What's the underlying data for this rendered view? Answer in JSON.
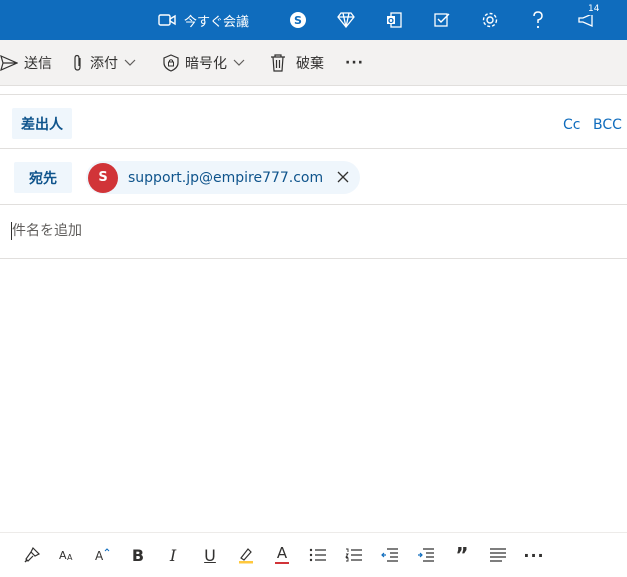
{
  "topbar": {
    "meet_now_label": "今すぐ会議",
    "notification_count": "14",
    "icons": [
      "video-icon",
      "skype-icon",
      "diamond-icon",
      "office-icon",
      "todo-icon",
      "gear-icon",
      "help-icon",
      "megaphone-icon"
    ],
    "accent": "#0f6cbd"
  },
  "toolbar": {
    "send_label": "送信",
    "attach_label": "添付",
    "encrypt_label": "暗号化",
    "discard_label": "破棄",
    "more_label": "···"
  },
  "compose": {
    "from_label": "差出人",
    "cc_label": "Cc",
    "bcc_label": "BCC",
    "to_label": "宛先",
    "recipient": {
      "initial": "S",
      "email": "support.jp@empire777.com",
      "avatar_color": "#d13438"
    },
    "subject_placeholder": "件名を追加"
  },
  "format_bar": {
    "icons": [
      "format-painter-icon",
      "font-size-icon",
      "text-effects-icon",
      "bold-icon",
      "italic-icon",
      "underline-icon",
      "highlight-icon",
      "font-color-icon",
      "bullets-icon",
      "numbering-icon",
      "decrease-indent-icon",
      "increase-indent-icon",
      "quote-icon",
      "align-icon",
      "more-icon"
    ],
    "bold_glyph": "B",
    "italic_glyph": "I",
    "underline_glyph": "U",
    "font_color_glyph": "A",
    "quote_glyph": "”",
    "more_glyph": "···"
  }
}
